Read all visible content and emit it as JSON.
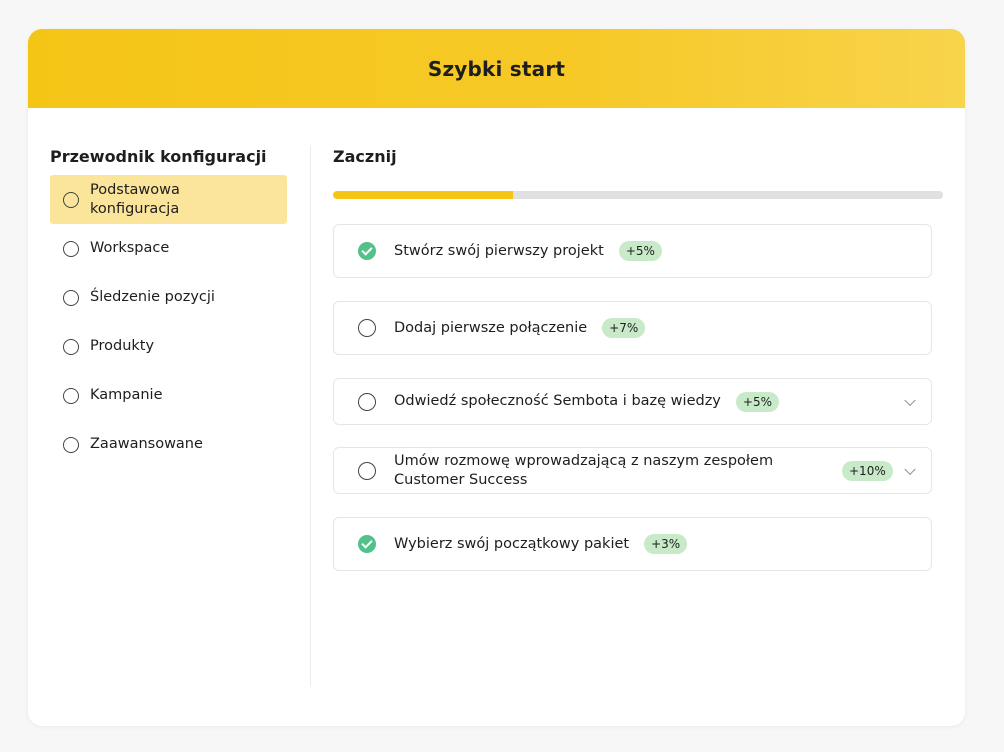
{
  "header": {
    "title": "Szybki start"
  },
  "sidebar": {
    "title": "Przewodnik konfiguracji",
    "items": [
      {
        "label": "Podstawowa konfiguracja",
        "active": true
      },
      {
        "label": "Workspace",
        "active": false
      },
      {
        "label": "Śledzenie pozycji",
        "active": false
      },
      {
        "label": "Produkty",
        "active": false
      },
      {
        "label": "Kampanie",
        "active": false
      },
      {
        "label": "Zaawansowane",
        "active": false
      }
    ]
  },
  "main": {
    "title": "Zacznij",
    "progress_percent": 29.5,
    "tasks": [
      {
        "title": "Stwórz swój pierwszy projekt",
        "badge": "+5%",
        "done": true,
        "expandable": false
      },
      {
        "title": "Dodaj pierwsze połączenie",
        "badge": "+7%",
        "done": false,
        "expandable": false
      },
      {
        "title": "Odwiedź społeczność Sembota i bazę wiedzy",
        "badge": "+5%",
        "done": false,
        "expandable": true
      },
      {
        "title": "Umów rozmowę wprowadzającą z naszym zespołem Customer Success",
        "badge": "+10%",
        "done": false,
        "expandable": true
      },
      {
        "title": "Wybierz swój początkowy pakiet",
        "badge": "+3%",
        "done": true,
        "expandable": false
      }
    ]
  },
  "colors": {
    "accent": "#f5c516",
    "active_bg": "#fbe59a",
    "done": "#52c18a",
    "badge_bg": "#c8eac9"
  }
}
